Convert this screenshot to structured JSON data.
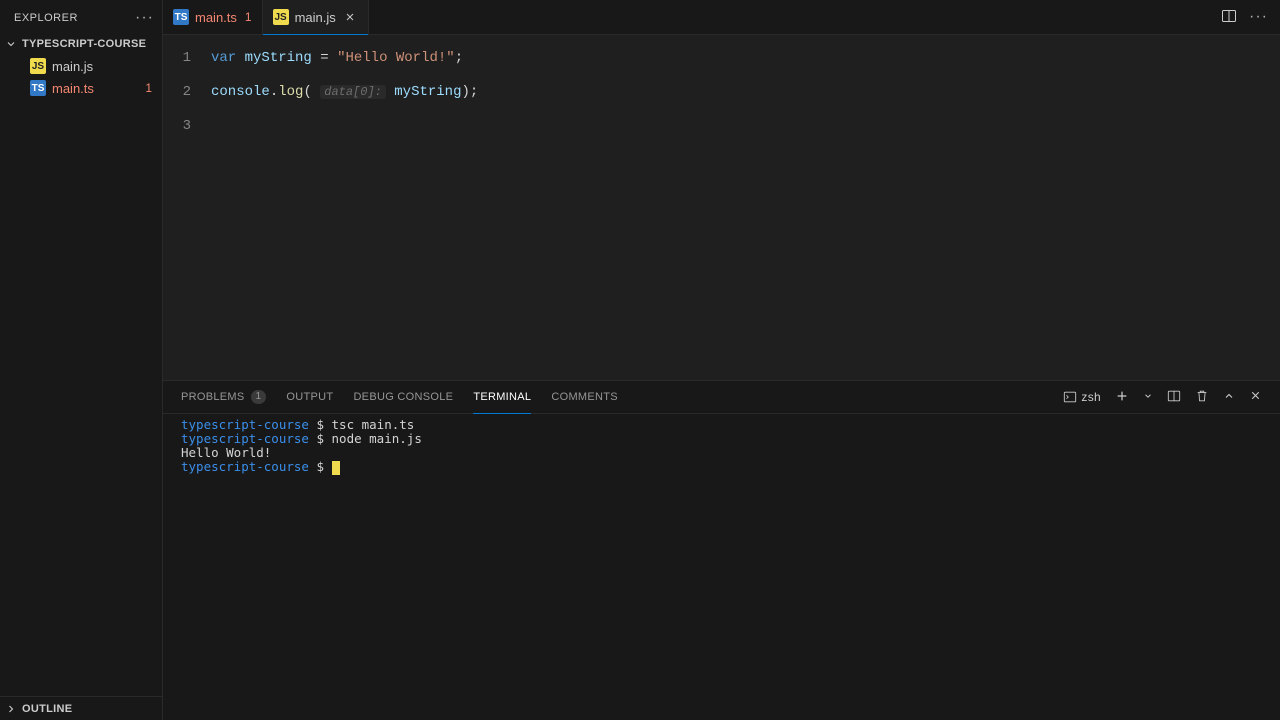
{
  "sidebar": {
    "title": "EXPLORER",
    "folder": "TYPESCRIPT-COURSE",
    "files": [
      {
        "name": "main.js",
        "icon": "JS",
        "iconClass": "js-icon",
        "error": false,
        "badge": ""
      },
      {
        "name": "main.ts",
        "icon": "TS",
        "iconClass": "ts-icon",
        "error": true,
        "badge": "1"
      }
    ],
    "outline": "OUTLINE"
  },
  "tabs": [
    {
      "label": "main.ts",
      "icon": "TS",
      "iconClass": "ts-icon",
      "error": true,
      "badge": "1",
      "active": false,
      "closable": false
    },
    {
      "label": "main.js",
      "icon": "JS",
      "iconClass": "js-icon",
      "error": false,
      "badge": "",
      "active": true,
      "closable": true
    }
  ],
  "code": {
    "line1": {
      "kw": "var",
      "ident": "myString",
      "eq": " = ",
      "str": "\"Hello World!\"",
      "end": ";"
    },
    "line2": {
      "obj": "console",
      "dot": ".",
      "fn": "log",
      "open": "(",
      "hint": "data[0]:",
      "sp": " ",
      "arg": "myString",
      "close": ");"
    }
  },
  "panel": {
    "tabs": {
      "problems": "PROBLEMS",
      "problemsCount": "1",
      "output": "OUTPUT",
      "debug": "DEBUG CONSOLE",
      "terminal": "TERMINAL",
      "comments": "COMMENTS"
    },
    "shell": "zsh",
    "terminal": {
      "cwd": "typescript-course",
      "prompt": "$",
      "lines": [
        {
          "cwd": "typescript-course",
          "prompt": "$",
          "cmd": "tsc main.ts"
        },
        {
          "cwd": "typescript-course",
          "prompt": "$",
          "cmd": "node main.js"
        }
      ],
      "output": "Hello World!",
      "lastCwd": "typescript-course",
      "lastPrompt": "$"
    }
  }
}
